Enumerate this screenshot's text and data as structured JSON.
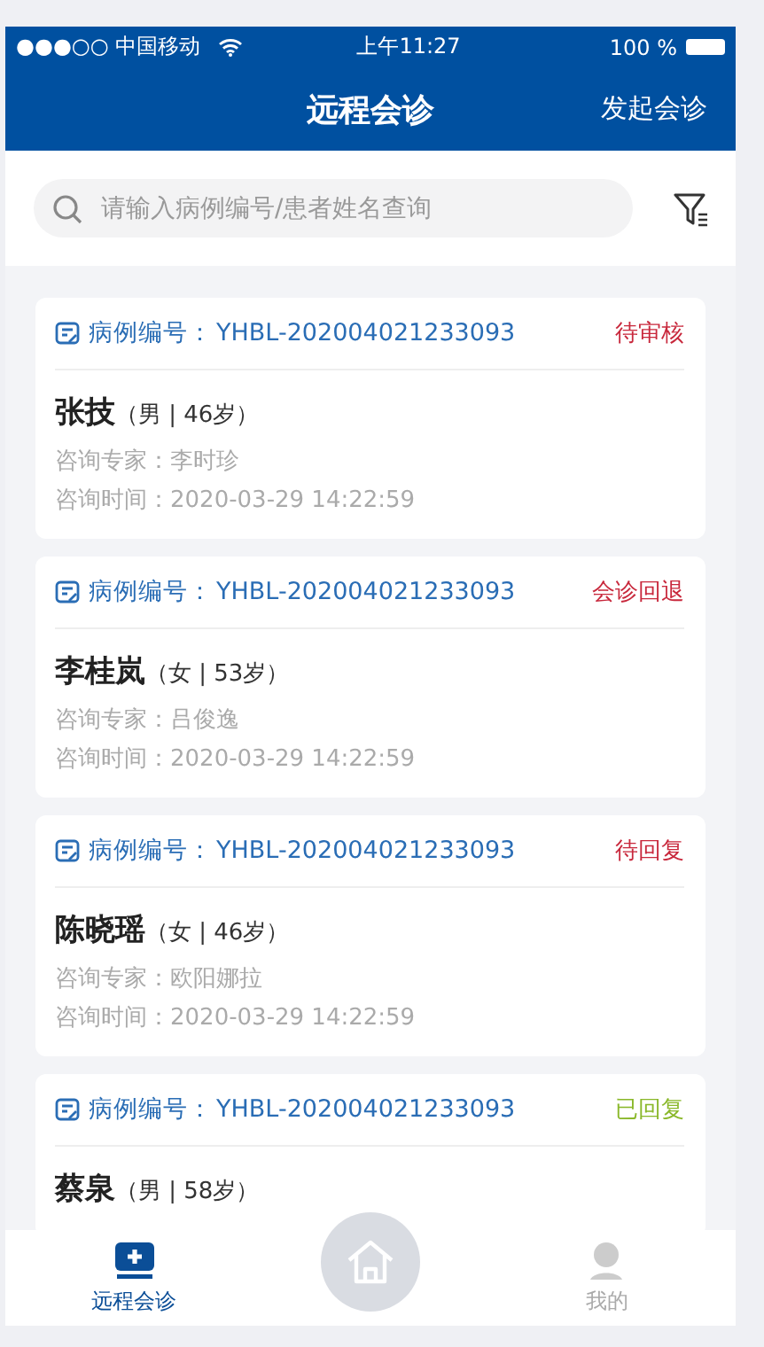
{
  "status_bar": {
    "carrier": "●●●○○ 中国移动",
    "time": "上午11:27",
    "battery": "100 %"
  },
  "nav": {
    "title": "远程会诊",
    "action": "发起会诊"
  },
  "search": {
    "placeholder": "请输入病例编号/患者姓名查询"
  },
  "cards": [
    {
      "case_label": "病例编号：",
      "case_id": "YHBL-202004021233093",
      "status": "待审核",
      "color": "#c8283c",
      "name": "张技",
      "info": "（男 | 46岁）",
      "expert_label": "咨询专家：",
      "expert": "李时珍",
      "time_label": "咨询时间：",
      "time": "2020-03-29 14:22:59"
    },
    {
      "case_label": "病例编号：",
      "case_id": "YHBL-202004021233093",
      "status": "会诊回退",
      "color": "#c8283c",
      "name": "李桂岚",
      "info": "（女 | 53岁）",
      "expert_label": "咨询专家：",
      "expert": "吕俊逸",
      "time_label": "咨询时间：",
      "time": "2020-03-29 14:22:59"
    },
    {
      "case_label": "病例编号：",
      "case_id": "YHBL-202004021233093",
      "status": "待回复",
      "color": "#c8283c",
      "name": "陈晓瑶",
      "info": "（女 | 46岁）",
      "expert_label": "咨询专家：",
      "expert": "欧阳娜拉",
      "time_label": "咨询时间：",
      "time": "2020-03-29 14:22:59"
    },
    {
      "case_label": "病例编号：",
      "case_id": "YHBL-202004021233093",
      "status": "已回复",
      "color": "#8ab82a",
      "name": "蔡泉",
      "info": "（男 | 58岁）"
    }
  ],
  "tabs": [
    {
      "kind": "consult",
      "label": "远程会诊",
      "selected": true
    },
    {
      "kind": "home"
    },
    {
      "kind": "profile",
      "label": "我的",
      "selected": false
    }
  ]
}
